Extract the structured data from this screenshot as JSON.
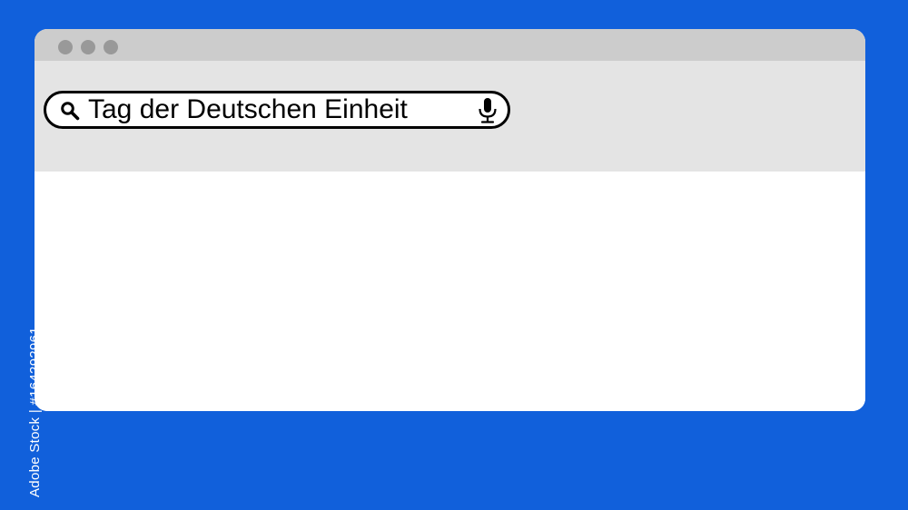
{
  "background_color": "#1160DB",
  "browser_window": {
    "title_bar_color": "#CCCCCC",
    "toolbar_color": "#E4E4E4",
    "content_color": "#FFFFFF",
    "window_control_dots": [
      "window-dot",
      "window-dot",
      "window-dot"
    ],
    "search_bar": {
      "value": "Tag der Deutschen Einheit",
      "search_icon": "search-icon",
      "mic_icon": "microphone-icon"
    }
  },
  "watermark": {
    "text": "Adobe Stock | #164292961"
  }
}
